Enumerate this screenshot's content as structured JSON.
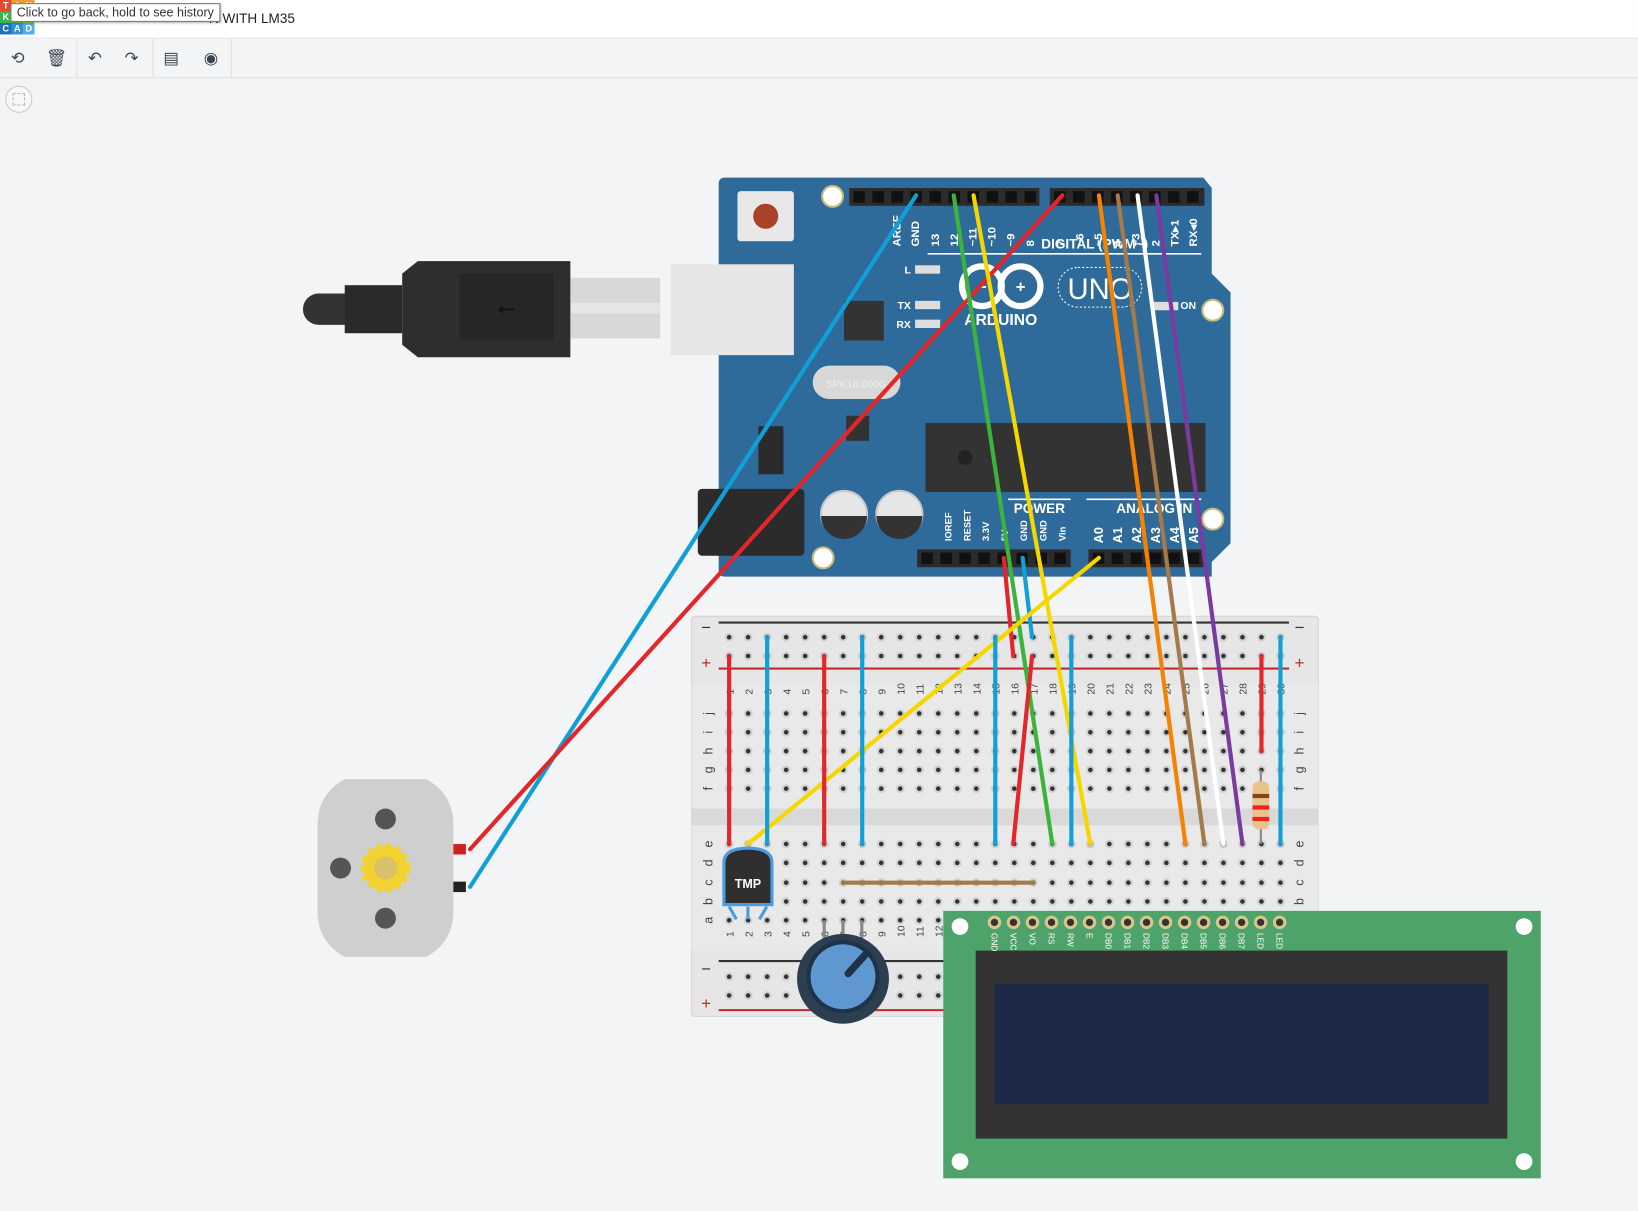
{
  "header": {
    "logo_letters": [
      "T",
      "I",
      "N",
      "K",
      "E",
      "R",
      "C",
      "A",
      "D"
    ],
    "logo_colors": [
      "#e8472b",
      "#f29a38",
      "#f29a38",
      "#3ab54a",
      "#6fbf44",
      "#8bc34a",
      "#1e6fb8",
      "#2f8fd8",
      "#55aee6"
    ],
    "title": "R WITH LM35",
    "tooltip": "Click to go back, hold to see history"
  },
  "toolbar": {
    "buttons": [
      {
        "name": "rotate-icon",
        "glyph": "⟲"
      },
      {
        "name": "delete-icon",
        "glyph": "🗑"
      },
      {
        "name": "undo-icon",
        "glyph": "↶"
      },
      {
        "name": "redo-icon",
        "glyph": "↷"
      },
      {
        "name": "notes-icon",
        "glyph": "▤"
      },
      {
        "name": "visibility-icon",
        "glyph": "◉"
      }
    ],
    "fit_view_icon": "fit-view-icon"
  },
  "arduino": {
    "digital_labels": [
      "AREF",
      "GND",
      "13",
      "12",
      "~11",
      "~10",
      "~9",
      "8",
      "7",
      "~6",
      "~5",
      "4",
      "~3",
      "2",
      "TX▸1",
      "RX◂0"
    ],
    "digital_title": "DIGITAL (PWM~)",
    "brand": "ARDUINO",
    "model": "UNO",
    "led_labels": [
      "L",
      "TX",
      "RX"
    ],
    "on_label": "ON",
    "crystal": "SPK16.000G",
    "power_title": "POWER",
    "power_labels": [
      "IOREF",
      "RESET",
      "3.3V",
      "5V",
      "GND",
      "GND",
      "Vin"
    ],
    "analog_title": "ANALOG IN",
    "analog_labels": [
      "A0",
      "A1",
      "A2",
      "A3",
      "A4",
      "A5"
    ],
    "color": "#2e6b9a"
  },
  "breadboard": {
    "rows_top": [
      "j",
      "i",
      "h",
      "g",
      "f"
    ],
    "rows_bottom": [
      "e",
      "d",
      "c",
      "b",
      "a"
    ],
    "minus": "−",
    "plus": "+",
    "columns": 30
  },
  "sensor": {
    "label": "TMP"
  },
  "lcd": {
    "pins": [
      "GND",
      "VCC",
      "VO",
      "RS",
      "RW",
      "E",
      "DB0",
      "DB1",
      "DB2",
      "DB3",
      "DB4",
      "DB5",
      "DB6",
      "DB7",
      "LED",
      "LED"
    ],
    "pcb_color": "#4ea36b",
    "screen_color": "#1c2946"
  },
  "wire_colors": {
    "red": "#e3262a",
    "blue": "#119fd8",
    "green": "#3cb43c",
    "yellow": "#f5d700",
    "orange": "#f58200",
    "brown": "#a57a4a",
    "white": "#ffffff",
    "purple": "#7b3aa0"
  }
}
